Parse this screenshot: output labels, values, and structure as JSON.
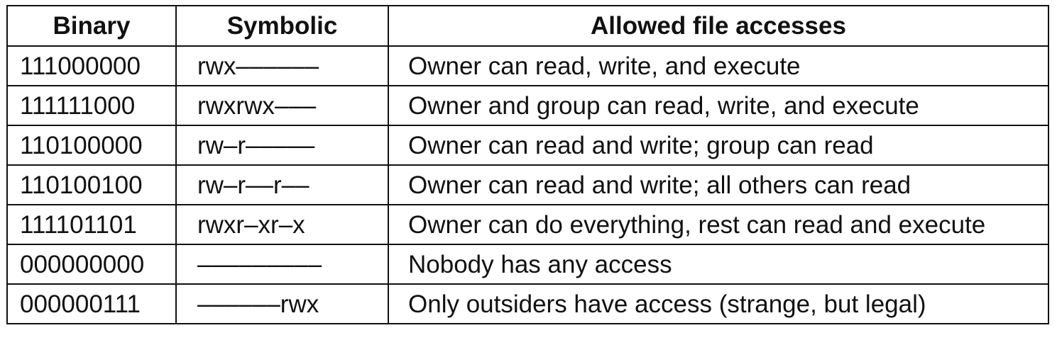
{
  "table": {
    "headers": [
      "Binary",
      "Symbolic",
      "Allowed file accesses"
    ],
    "rows": [
      [
        "111000000",
        "rwx––––––",
        "Owner can read, write, and execute"
      ],
      [
        "111111000",
        "rwxrwx–––",
        "Owner and group can read, write, and execute"
      ],
      [
        "110100000",
        "rw–r–––––",
        "Owner can read and write; group can read"
      ],
      [
        "110100100",
        "rw–r––r––",
        "Owner can read and write; all others can read"
      ],
      [
        "111101101",
        "rwxr–xr–x",
        "Owner can do everything, rest can read and execute"
      ],
      [
        "000000000",
        "–––––––––",
        "Nobody has any access"
      ],
      [
        "000000111",
        "––––––rwx",
        "Only outsiders have access (strange, but legal)"
      ]
    ]
  }
}
